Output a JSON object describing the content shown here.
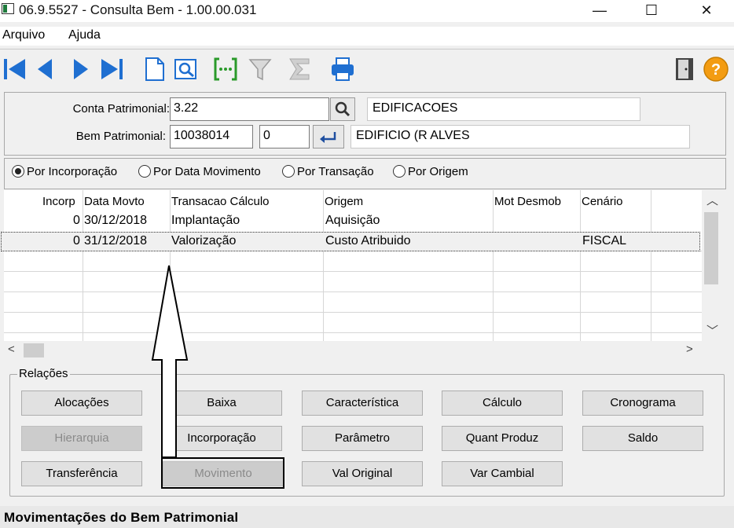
{
  "window": {
    "title": "06.9.5527 - Consulta Bem - 1.00.00.031",
    "minimize": "—",
    "maximize": "☐",
    "close": "✕"
  },
  "menu": [
    "Arquivo",
    "Ajuda"
  ],
  "toolbar": {
    "icons": [
      "first-record-icon",
      "previous-record-icon",
      "next-record-icon",
      "last-record-icon",
      "new-document-icon",
      "preview-icon",
      "select-columns-icon",
      "filter-icon",
      "sum-icon",
      "print-icon",
      "exit-door-icon",
      "help-icon"
    ],
    "help_glyph": "?"
  },
  "form": {
    "conta_label": "Conta Patrimonial:",
    "conta_value": "3.22",
    "conta_desc": "EDIFICACOES",
    "bem_label": "Bem Patrimonial:",
    "bem_value": "10038014",
    "bem_seq": "0",
    "bem_desc": "EDIFICIO (R ALVES"
  },
  "radio_options": [
    {
      "label": "Por Incorporação",
      "selected": true
    },
    {
      "label": "Por Data Movimento",
      "selected": false
    },
    {
      "label": "Por Transação",
      "selected": false
    },
    {
      "label": "Por Origem",
      "selected": false
    }
  ],
  "grid": {
    "columns": [
      "Incorp",
      "Data Movto",
      "Transacao Cálculo",
      "Origem",
      "Mot Desmob",
      "Cenário"
    ],
    "rows": [
      [
        "0",
        "30/12/2018",
        "Implantação",
        "Aquisição",
        "",
        ""
      ],
      [
        "0",
        "31/12/2018",
        "Valorização",
        "Custo Atribuido",
        "",
        "FISCAL"
      ]
    ],
    "selected_row": 1
  },
  "relations": {
    "title": "Relações",
    "buttons": [
      {
        "label": "Alocações",
        "enabled": true
      },
      {
        "label": "Baixa",
        "enabled": true
      },
      {
        "label": "Característica",
        "enabled": true
      },
      {
        "label": "Cálculo",
        "enabled": true
      },
      {
        "label": "Cronograma",
        "enabled": true
      },
      {
        "label": "Hierarquia",
        "enabled": false
      },
      {
        "label": "Incorporação",
        "enabled": true
      },
      {
        "label": "Parâmetro",
        "enabled": true
      },
      {
        "label": "Quant Produz",
        "enabled": true
      },
      {
        "label": "Saldo",
        "enabled": true
      },
      {
        "label": "Transferência",
        "enabled": true
      },
      {
        "label": "Movimento",
        "enabled": false
      },
      {
        "label": "Val Original",
        "enabled": true
      },
      {
        "label": "Var Cambial",
        "enabled": true
      }
    ]
  },
  "status": "Movimentações do Bem Patrimonial"
}
